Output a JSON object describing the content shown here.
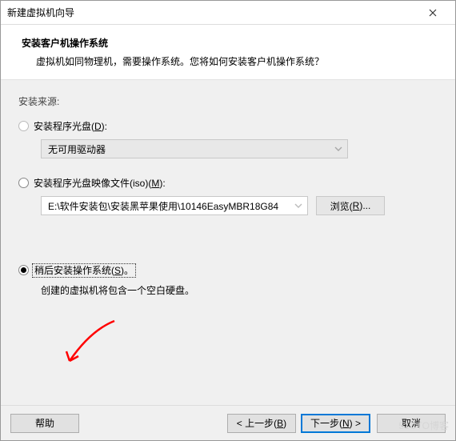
{
  "titlebar": {
    "title": "新建虚拟机向导"
  },
  "header": {
    "heading": "安装客户机操作系统",
    "sub": "虚拟机如同物理机，需要操作系统。您将如何安装客户机操作系统？"
  },
  "source_label": "安装来源:",
  "opt_disc": {
    "label_pre": "安装程序光盘(",
    "key": "D",
    "label_post": "):",
    "drive_text": "无可用驱动器"
  },
  "opt_iso": {
    "label_pre": "安装程序光盘映像文件(iso)(",
    "key": "M",
    "label_post": "):",
    "path": "E:\\软件安装包\\安装黑苹果使用\\10146EasyMBR18G84",
    "browse_pre": "浏览(",
    "browse_key": "R",
    "browse_post": ")..."
  },
  "opt_later": {
    "label_pre": "稍后安装操作系统(",
    "key": "S",
    "label_post": ")。",
    "hint": "创建的虚拟机将包含一个空白硬盘。"
  },
  "footer": {
    "help": "帮助",
    "back_pre": "< 上一步(",
    "back_key": "B",
    "back_post": ")",
    "next_pre": "下一步(",
    "next_key": "N",
    "next_post": ") >",
    "cancel": "取消"
  },
  "watermark": "51CTO博客"
}
